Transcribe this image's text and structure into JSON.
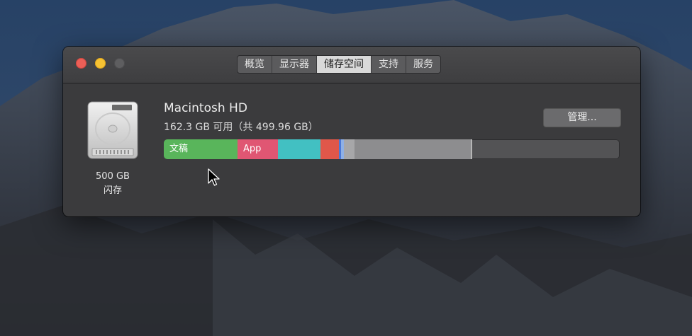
{
  "window": {
    "tabs": [
      {
        "label": "概览",
        "active": false
      },
      {
        "label": "显示器",
        "active": false
      },
      {
        "label": "储存空间",
        "active": true
      },
      {
        "label": "支持",
        "active": false
      },
      {
        "label": "服务",
        "active": false
      }
    ]
  },
  "disk": {
    "size": "500 GB",
    "type": "闪存"
  },
  "volume": {
    "name": "Macintosh HD",
    "info": "162.3 GB 可用（共 499.96 GB）"
  },
  "manage_button": "管理...",
  "storage_bar": {
    "segments": [
      {
        "label": "文稿",
        "color": "#59b55b"
      },
      {
        "label": "App",
        "color": "#e05673"
      },
      {
        "label": "",
        "color": "#42c0c2"
      },
      {
        "label": "",
        "color": "#e0574a"
      },
      {
        "label": "",
        "color": "#4b79d8"
      },
      {
        "label": "",
        "color": "#8d8d8f"
      }
    ],
    "free_fraction": 0.325
  },
  "colors": {
    "traffic_close": "#ec5f57",
    "traffic_minimize": "#f6c233",
    "traffic_zoom": "#5e5e60"
  }
}
